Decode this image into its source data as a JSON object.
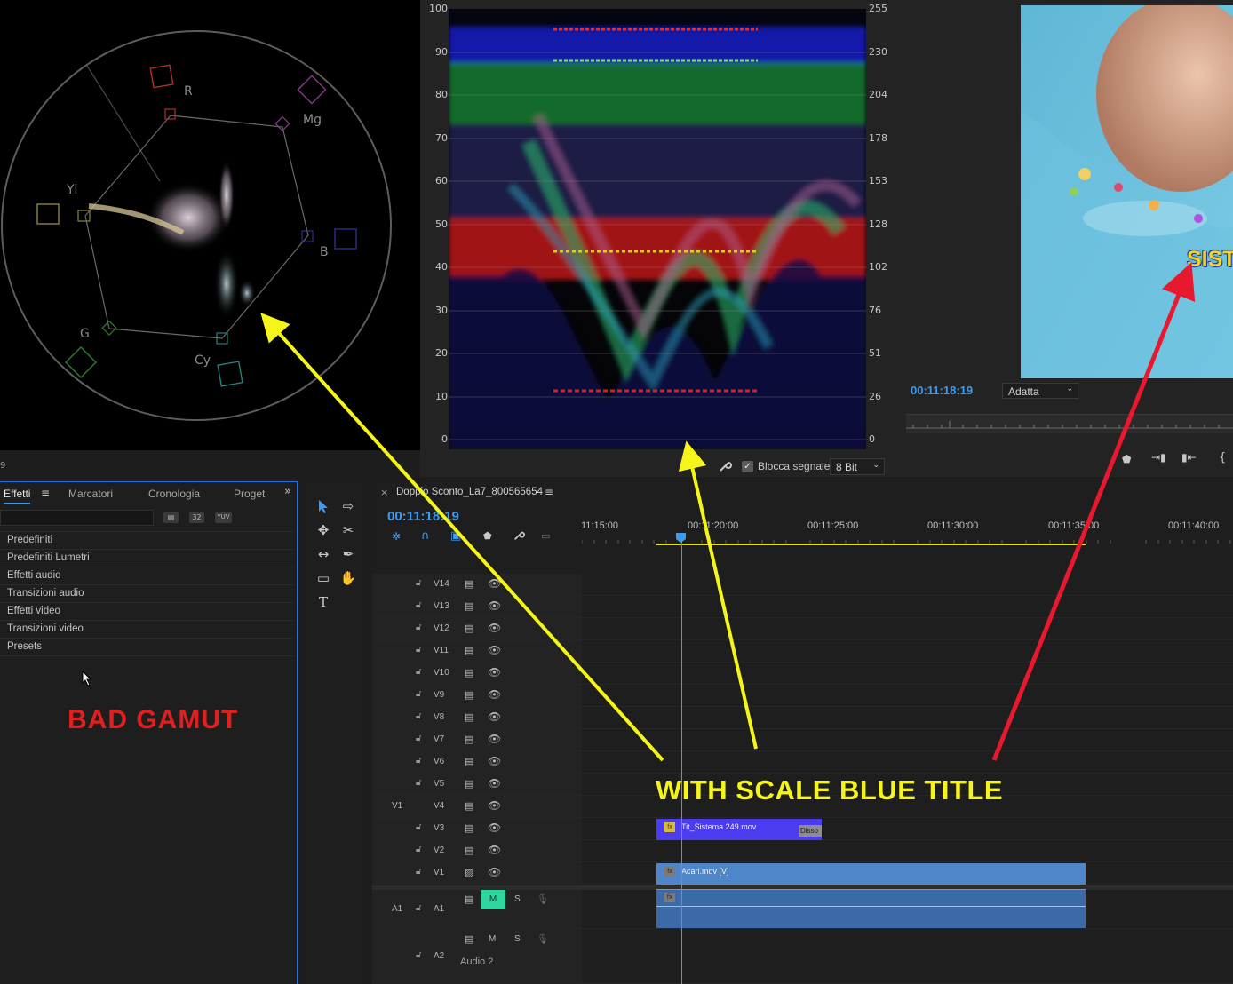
{
  "vectorscope": {
    "targets": {
      "r": "R",
      "mg": "Mg",
      "yl": "Yl",
      "b": "B",
      "g": "G",
      "cy": "Cy"
    },
    "bottom_cut_text": "9"
  },
  "parade": {
    "left_scale": [
      "100",
      "90",
      "80",
      "70",
      "60",
      "50",
      "40",
      "30",
      "20",
      "10",
      "0"
    ],
    "right_scale": [
      "255",
      "230",
      "204",
      "178",
      "153",
      "128",
      "102",
      "76",
      "51",
      "26",
      "0"
    ],
    "lock_signal_label": "Blocca segnale",
    "bit_depth": "8 Bit"
  },
  "program_monitor": {
    "timecode": "00:11:18:19",
    "fit_option": "Adatta",
    "video_title_partial": "SIST"
  },
  "effects_panel": {
    "tabs": [
      "Effetti",
      "Marcatori",
      "Cronologia",
      "Proget"
    ],
    "search_placeholder": "",
    "filter_badges": [
      "32",
      "YUV"
    ],
    "items": [
      "Predefiniti",
      "Predefiniti Lumetri",
      "Effetti audio",
      "Transizioni audio",
      "Effetti video",
      "Transizioni video",
      "Presets"
    ],
    "annotation": "BAD GAMUT"
  },
  "timeline": {
    "sequence_name": "Doppio Sconto_La7_800565654",
    "timecode": "00:11:18:19",
    "ruler": [
      "11:15:00",
      "00:11:20:00",
      "00:11:25:00",
      "00:11:30:00",
      "00:11:35:00",
      "00:11:40:00"
    ],
    "video_tracks": [
      "V14",
      "V13",
      "V12",
      "V11",
      "V10",
      "V9",
      "V8",
      "V7",
      "V6",
      "V5",
      "V4",
      "V3",
      "V2",
      "V1"
    ],
    "source_video": "V1",
    "source_audio": "A1",
    "audio_tracks": [
      {
        "name": "A1",
        "m": "M",
        "s": "S"
      },
      {
        "name": "A2",
        "m": "M",
        "s": "S",
        "label": "Audio 2"
      }
    ],
    "clips": {
      "title_clip": "Tit_Sistema 249.mov",
      "transition": "Disso",
      "video_clip": "Acari.mov [V]"
    }
  },
  "annotations": {
    "main_caption": "WITH SCALE BLUE TITLE"
  },
  "colors": {
    "accent_blue": "#3e9bf0",
    "annotation_yellow": "#f5f51a",
    "annotation_red": "#e8182f",
    "bad_gamut_red": "#e0201e",
    "title_clip": "#4b3cf0",
    "video_clip": "#4f86c9"
  }
}
